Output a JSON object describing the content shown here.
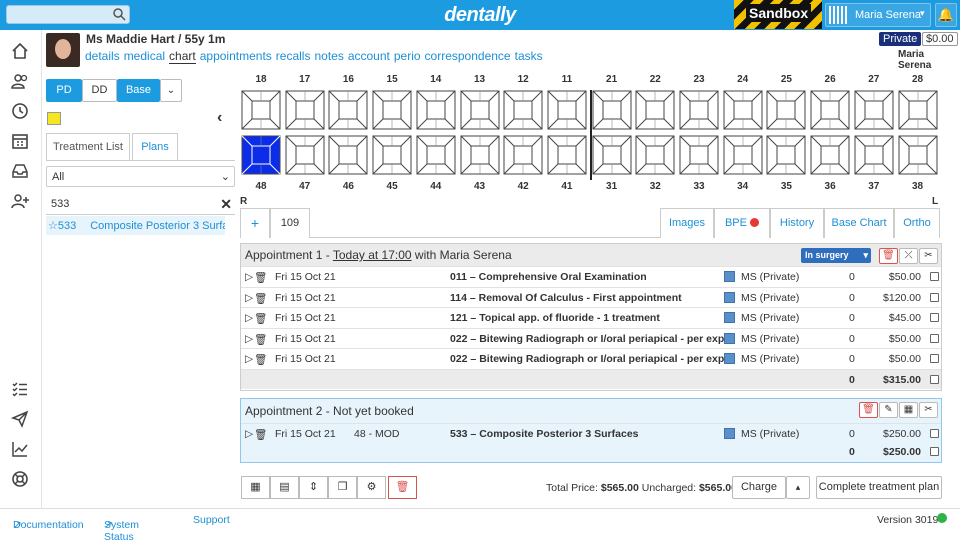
{
  "app": {
    "brand": "dentally",
    "sandbox": "Sandbox",
    "user": "Maria Serena"
  },
  "patient": {
    "title": "Ms Maddie Hart / 55y 1m",
    "nav": [
      "details",
      "medical",
      "chart",
      "appointments",
      "recalls",
      "notes",
      "account",
      "perio",
      "correspondence",
      "tasks"
    ],
    "active_nav": "chart",
    "badge": "Private",
    "balance": "$0.00",
    "dentist": "Maria Serena"
  },
  "left": {
    "mode_buttons": [
      "PD",
      "DD",
      "Base"
    ],
    "tabs": [
      "Treatment List",
      "Plans"
    ],
    "filter": "All",
    "code": "533",
    "result_code": "533",
    "result_label": "Composite Posterior 3 Surfa..."
  },
  "teeth": {
    "upper": [
      "18",
      "17",
      "16",
      "15",
      "14",
      "13",
      "12",
      "11",
      "21",
      "22",
      "23",
      "24",
      "25",
      "26",
      "27",
      "28"
    ],
    "lower": [
      "48",
      "47",
      "46",
      "45",
      "44",
      "43",
      "42",
      "41",
      "31",
      "32",
      "33",
      "34",
      "35",
      "36",
      "37",
      "38"
    ],
    "right_label": "R",
    "left_label": "L",
    "selected_tooth": "48",
    "selected_color": "#0b2ce8"
  },
  "apptabs": {
    "add": "+",
    "number": "109",
    "tabs": [
      "Images",
      "BPE",
      "History",
      "Base Chart",
      "Ortho"
    ]
  },
  "appt1": {
    "prefix": "Appointment 1 - ",
    "when": "Today at 17:00",
    "suffix": " with Maria Serena",
    "status": "In surgery",
    "total_count": "0",
    "total": "$315.00",
    "rows": [
      {
        "date": "Fri 15 Oct 21",
        "tooth": "",
        "desc": "011 – Comprehensive Oral Examination",
        "prov": "MS (Private)",
        "qty": "0",
        "price": "$50.00"
      },
      {
        "date": "Fri 15 Oct 21",
        "tooth": "",
        "desc": "114 – Removal Of Calculus - First appointment",
        "prov": "MS (Private)",
        "qty": "0",
        "price": "$120.00"
      },
      {
        "date": "Fri 15 Oct 21",
        "tooth": "",
        "desc": "121 – Topical app. of fluoride - 1 treatment",
        "prov": "MS (Private)",
        "qty": "0",
        "price": "$45.00"
      },
      {
        "date": "Fri 15 Oct 21",
        "tooth": "",
        "desc": "022 – Bitewing Radiograph or I/oral periapical - per exp",
        "prov": "MS (Private)",
        "qty": "0",
        "price": "$50.00"
      },
      {
        "date": "Fri 15 Oct 21",
        "tooth": "",
        "desc": "022 – Bitewing Radiograph or I/oral periapical - per exp",
        "prov": "MS (Private)",
        "qty": "0",
        "price": "$50.00"
      }
    ]
  },
  "appt2": {
    "title": "Appointment 2 - Not yet booked",
    "total_count": "0",
    "total": "$250.00",
    "rows": [
      {
        "date": "Fri 15 Oct 21",
        "tooth": "48 - MOD",
        "desc": "533 – Composite Posterior 3 Surfaces",
        "prov": "MS (Private)",
        "qty": "0",
        "price": "$250.00"
      }
    ]
  },
  "footer": {
    "total_label": "Total Price:",
    "total": "$565.00",
    "uncharged_label": "Uncharged:",
    "uncharged": "$565.00",
    "charge": "Charge",
    "complete": "Complete treatment plan"
  },
  "bottom": {
    "documentation": "Documentation",
    "status": "System Status",
    "support": "Support",
    "version": "Version 3019"
  },
  "colors": {
    "accent": "#1d9be0",
    "navy": "#1a2f7a",
    "danger": "#d9534f",
    "status_ok": "#2fb344"
  }
}
